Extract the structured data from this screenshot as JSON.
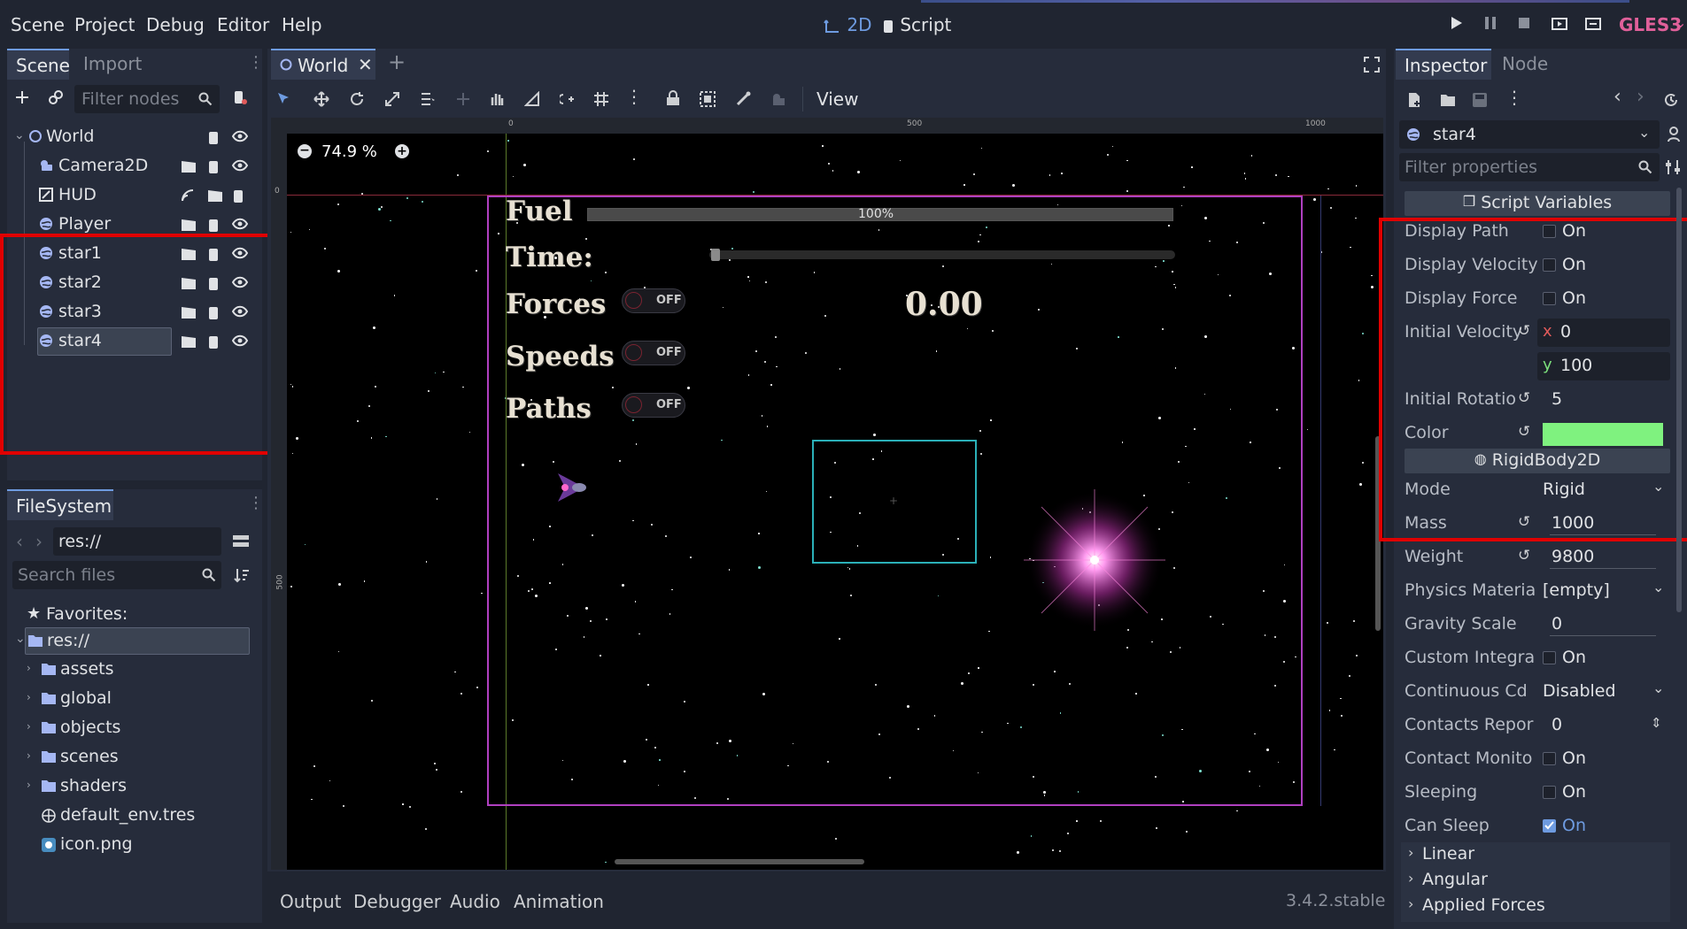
{
  "menubar": {
    "items": [
      "Scene",
      "Project",
      "Debug",
      "Editor",
      "Help"
    ],
    "center": {
      "mode_2d": "2D",
      "script": "Script"
    },
    "renderer": "GLES3",
    "accent_color": "#6e9be0"
  },
  "scene_dock": {
    "tabs": [
      "Scene",
      "Import"
    ],
    "filter_placeholder": "Filter nodes",
    "tree": [
      {
        "label": "World",
        "icon": "node2d-icon"
      },
      {
        "label": "Camera2D",
        "icon": "camera-icon"
      },
      {
        "label": "HUD",
        "icon": "canvaslayer-icon"
      },
      {
        "label": "Player",
        "icon": "rigidbody-icon"
      },
      {
        "label": "star1",
        "icon": "rigidbody-icon"
      },
      {
        "label": "star2",
        "icon": "rigidbody-icon"
      },
      {
        "label": "star3",
        "icon": "rigidbody-icon"
      },
      {
        "label": "star4",
        "icon": "rigidbody-icon",
        "selected": true
      }
    ]
  },
  "filesystem": {
    "tab": "FileSystem",
    "path": "res://",
    "search_placeholder": "Search files",
    "favorites": "Favorites:",
    "root": "res://",
    "items": [
      "assets",
      "global",
      "objects",
      "scenes",
      "shaders",
      "default_env.tres",
      "icon.png"
    ]
  },
  "viewport": {
    "scene_tab": "World",
    "toolbar_view": "View",
    "zoom": "74.9 %",
    "ruler": {
      "t0": "0",
      "t500": "500",
      "t1000": "1000",
      "v0": "0",
      "v500": "500"
    },
    "hud": {
      "fuel_label": "Fuel",
      "fuel_value": "100%",
      "fuel_fraction": 1.0,
      "time_label": "Time:",
      "forces_label": "Forces",
      "speeds_label": "Speeds",
      "paths_label": "Paths",
      "toggle_text": "OFF",
      "score": "0.00"
    }
  },
  "bottom_panel": {
    "tabs": [
      "Output",
      "Debugger",
      "Audio",
      "Animation"
    ],
    "version": "3.4.2.stable"
  },
  "inspector": {
    "tabs": [
      "Inspector",
      "Node"
    ],
    "object": "star4",
    "filter_placeholder": "Filter properties",
    "sections": {
      "script_vars": "Script Variables",
      "rigidbody": "RigidBody2D"
    },
    "props": {
      "display_path": {
        "label": "Display Path",
        "value": "On"
      },
      "display_velocity": {
        "label": "Display Velocity",
        "value": "On"
      },
      "display_force": {
        "label": "Display Force",
        "value": "On"
      },
      "initial_velocity": {
        "label": "Initial Velocity",
        "x_label": "x",
        "x": "0",
        "y_label": "y",
        "y": "100"
      },
      "initial_rotation": {
        "label": "Initial Rotatio",
        "value": "5"
      },
      "color": {
        "label": "Color",
        "value": "#7ff27f"
      },
      "mode": {
        "label": "Mode",
        "value": "Rigid"
      },
      "mass": {
        "label": "Mass",
        "value": "1000"
      },
      "weight": {
        "label": "Weight",
        "value": "9800"
      },
      "physics_material": {
        "label": "Physics Materia",
        "value": "[empty]"
      },
      "gravity_scale": {
        "label": "Gravity Scale",
        "value": "0"
      },
      "custom_integrator": {
        "label": "Custom Integra",
        "value": "On"
      },
      "continuous_cd": {
        "label": "Continuous Cd",
        "value": "Disabled"
      },
      "contacts_reported": {
        "label": "Contacts Repor",
        "value": "0"
      },
      "contact_monitor": {
        "label": "Contact Monito",
        "value": "On"
      },
      "sleeping": {
        "label": "Sleeping",
        "value": "On"
      },
      "can_sleep": {
        "label": "Can Sleep",
        "value": "On",
        "checked": true
      }
    },
    "groups": [
      "Linear",
      "Angular",
      "Applied Forces"
    ]
  }
}
